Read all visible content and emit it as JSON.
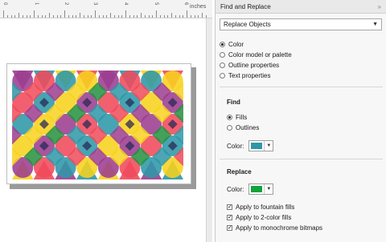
{
  "ruler": {
    "numbers": [
      "0",
      "1",
      "2",
      "3",
      "4",
      "5",
      "6"
    ],
    "unit": "inches"
  },
  "docker": {
    "title": "Find and Replace",
    "mode_select": "Replace Objects",
    "object_options": [
      {
        "label": "Color",
        "selected": true
      },
      {
        "label": "Color model or palette",
        "selected": false
      },
      {
        "label": "Outline properties",
        "selected": false
      },
      {
        "label": "Text properties",
        "selected": false
      }
    ],
    "find": {
      "title": "Find",
      "options": [
        {
          "label": "Fills",
          "selected": true
        },
        {
          "label": "Outlines",
          "selected": false
        }
      ],
      "color_label": "Color:",
      "color": "#2e97a7"
    },
    "replace": {
      "title": "Replace",
      "color_label": "Color:",
      "color": "#12a33a",
      "checks": [
        {
          "label": "Apply to fountain fills",
          "checked": true
        },
        {
          "label": "Apply to 2-color fills",
          "checked": true
        },
        {
          "label": "Apply to monochrome bitmaps",
          "checked": true
        }
      ]
    }
  },
  "art_colors": {
    "red": "#f04a5b",
    "purple": "#9c3d8f",
    "teal": "#2e97a7",
    "yellow": "#f7d21e",
    "green": "#23913e"
  }
}
